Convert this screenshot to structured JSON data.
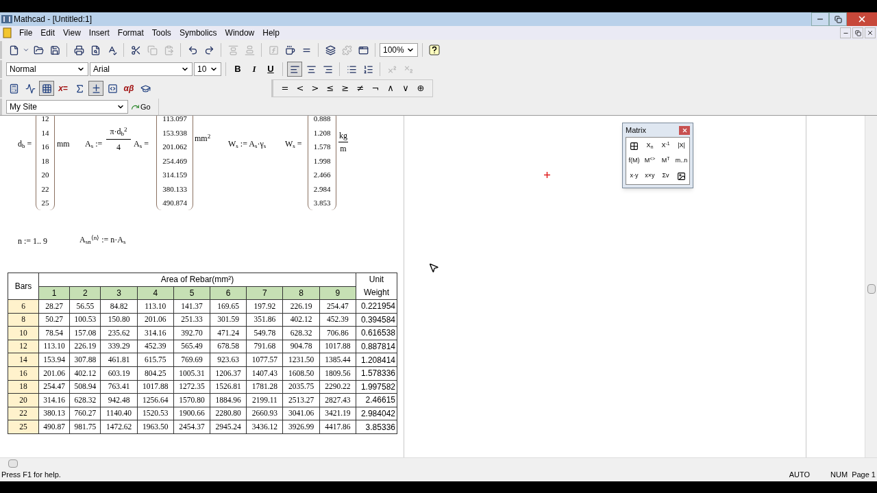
{
  "window": {
    "title": "Mathcad - [Untitled:1]"
  },
  "menu": [
    "File",
    "Edit",
    "View",
    "Insert",
    "Format",
    "Tools",
    "Symbolics",
    "Window",
    "Help"
  ],
  "standard_toolbar": {
    "buttons": [
      {
        "disabled": false
      },
      {
        "disabled": false
      },
      {
        "disabled": false
      },
      {
        "disabled": false
      },
      {
        "disabled": false
      },
      {
        "disabled": false
      },
      {
        "disabled": false
      },
      {
        "disabled": false
      },
      {
        "disabled": true
      },
      {
        "disabled": true
      },
      {
        "disabled": false
      },
      {
        "disabled": false
      },
      {
        "disabled": true
      },
      {
        "disabled": true
      },
      {
        "disabled": true
      },
      {
        "disabled": false
      },
      {
        "disabled": false
      },
      {
        "disabled": false
      },
      {
        "disabled": true
      },
      {
        "disabled": false
      },
      {
        "disabled": false
      }
    ],
    "zoom": "100%"
  },
  "formatting_toolbar": {
    "style": "Normal",
    "font": "Arial",
    "size": "10",
    "text_buttons": [
      "B",
      "I",
      "U"
    ],
    "buttons": [
      {
        "selected": true,
        "disabled": false
      },
      {
        "selected": false,
        "disabled": false
      },
      {
        "selected": false,
        "disabled": false
      },
      {
        "selected": false,
        "disabled": false
      },
      {
        "selected": false,
        "disabled": false
      },
      {
        "selected": false,
        "disabled": true
      },
      {
        "selected": false,
        "disabled": true
      }
    ]
  },
  "math_toolbar": [
    {
      "kind": "icon",
      "selected": false
    },
    {
      "kind": "icon",
      "selected": false
    },
    {
      "kind": "icon",
      "selected": true
    },
    {
      "kind": "text",
      "label": "x=",
      "selected": false
    },
    {
      "kind": "icon",
      "selected": false
    },
    {
      "kind": "icon",
      "selected": true
    },
    {
      "kind": "icon",
      "selected": false
    },
    {
      "kind": "text",
      "label": "αβ",
      "selected": false
    },
    {
      "kind": "icon",
      "selected": false
    }
  ],
  "boolean_palette": [
    "=",
    "<",
    ">",
    "≤",
    "≥",
    "≠",
    "¬",
    "∧",
    "∨",
    "⊕"
  ],
  "resources_toolbar": {
    "site": "My Site",
    "go": "Go"
  },
  "worksheet": {
    "db": {
      "lhs": "d$_{b}$ =",
      "values": [
        "12",
        "14",
        "16",
        "18",
        "20",
        "22",
        "25"
      ],
      "unit": "mm"
    },
    "as_def": {
      "lhs": "A$_{s}$ :=",
      "numerator": "π·d$_{b}$$^{2}$",
      "denominator": "4"
    },
    "as": {
      "lhs": "A$_{s}$ =",
      "values": [
        "113.097",
        "153.938",
        "201.062",
        "254.469",
        "314.159",
        "380.133",
        "490.874"
      ],
      "unit": "mm$^{2}$"
    },
    "ws_def": "W$_{s}$ := A$_{s}$·γ$_{s}$",
    "ws": {
      "lhs": "W$_{s}$ =",
      "values": [
        "0.888",
        "1.208",
        "1.578",
        "1.998",
        "2.466",
        "2.984",
        "3.853"
      ],
      "unit_numerator": "kg",
      "unit_denominator": "m"
    },
    "range": "n := 1.. 9",
    "asn_def": "A$_{sn}$$^{⟨n⟩}$ := n·A$_{s}$",
    "table": {
      "bars_header": "Bars",
      "area_header": "Area of Rebar(mm²)",
      "weight_header": "Unit Weight",
      "columns": [
        "1",
        "2",
        "3",
        "4",
        "5",
        "6",
        "7",
        "8",
        "9"
      ],
      "rows": [
        {
          "bars": "6",
          "values": [
            "28.27",
            "56.55",
            "84.82",
            "113.10",
            "141.37",
            "169.65",
            "197.92",
            "226.19",
            "254.47"
          ],
          "weight": "0.221954"
        },
        {
          "bars": "8",
          "values": [
            "50.27",
            "100.53",
            "150.80",
            "201.06",
            "251.33",
            "301.59",
            "351.86",
            "402.12",
            "452.39"
          ],
          "weight": "0.394584"
        },
        {
          "bars": "10",
          "values": [
            "78.54",
            "157.08",
            "235.62",
            "314.16",
            "392.70",
            "471.24",
            "549.78",
            "628.32",
            "706.86"
          ],
          "weight": "0.616538"
        },
        {
          "bars": "12",
          "values": [
            "113.10",
            "226.19",
            "339.29",
            "452.39",
            "565.49",
            "678.58",
            "791.68",
            "904.78",
            "1017.88"
          ],
          "weight": "0.887814"
        },
        {
          "bars": "14",
          "values": [
            "153.94",
            "307.88",
            "461.81",
            "615.75",
            "769.69",
            "923.63",
            "1077.57",
            "1231.50",
            "1385.44"
          ],
          "weight": "1.208414"
        },
        {
          "bars": "16",
          "values": [
            "201.06",
            "402.12",
            "603.19",
            "804.25",
            "1005.31",
            "1206.37",
            "1407.43",
            "1608.50",
            "1809.56"
          ],
          "weight": "1.578336"
        },
        {
          "bars": "18",
          "values": [
            "254.47",
            "508.94",
            "763.41",
            "1017.88",
            "1272.35",
            "1526.81",
            "1781.28",
            "2035.75",
            "2290.22"
          ],
          "weight": "1.997582"
        },
        {
          "bars": "20",
          "values": [
            "314.16",
            "628.32",
            "942.48",
            "1256.64",
            "1570.80",
            "1884.96",
            "2199.11",
            "2513.27",
            "2827.43"
          ],
          "weight": "2.46615"
        },
        {
          "bars": "22",
          "values": [
            "380.13",
            "760.27",
            "1140.40",
            "1520.53",
            "1900.66",
            "2280.80",
            "2660.93",
            "3041.06",
            "3421.19"
          ],
          "weight": "2.984042"
        },
        {
          "bars": "25",
          "values": [
            "490.87",
            "981.75",
            "1472.62",
            "1963.50",
            "2454.37",
            "2945.24",
            "3436.12",
            "3926.99",
            "4417.86"
          ],
          "weight": "3.85336"
        }
      ]
    }
  },
  "matrix_palette": {
    "title": "Matrix",
    "buttons": [
      {
        "kind": "icon"
      },
      {
        "kind": "text",
        "label": "X$_{n}$"
      },
      {
        "kind": "text",
        "label": "X$^{-1}$"
      },
      {
        "kind": "text",
        "label": "|X|"
      },
      {
        "kind": "text",
        "label": "f(M)"
      },
      {
        "kind": "text",
        "label": "M$^{<>}$"
      },
      {
        "kind": "text",
        "label": "M$^{T}$"
      },
      {
        "kind": "text",
        "label": "m..n"
      },
      {
        "kind": "text",
        "label": "x·y"
      },
      {
        "kind": "text",
        "label": "x×y"
      },
      {
        "kind": "text",
        "label": "Σv"
      },
      {
        "kind": "icon"
      }
    ]
  },
  "status_bar": {
    "message": "Press F1 for help.",
    "mode": "AUTO",
    "num": "NUM",
    "page": "Page 1"
  }
}
